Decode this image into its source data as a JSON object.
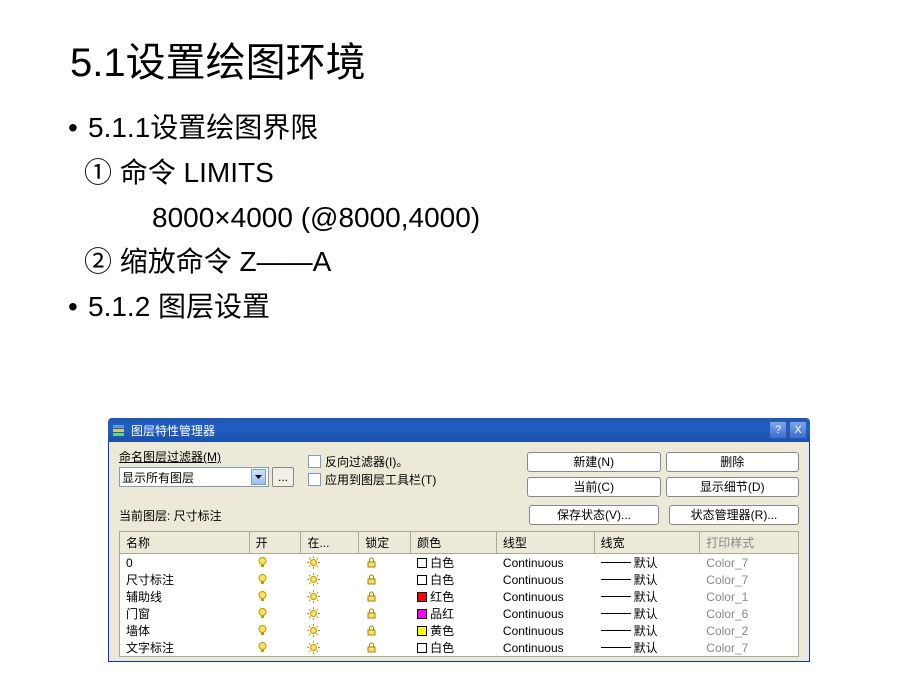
{
  "heading": "5.1设置绘图环境",
  "bullets": {
    "b1": "5.1.1设置绘图界限",
    "s1": "① 命令 LIMITS",
    "s2": "8000×4000 (@8000,4000)",
    "s3": "② 缩放命令 Z——A",
    "b2": "5.1.2 图层设置"
  },
  "dialog": {
    "title": "图层特性管理器",
    "help_btn": "?",
    "close_btn": "X",
    "named_filters_label": "命名图层过滤器(M)",
    "filter_combo_value": "显示所有图层",
    "ellipsis": "...",
    "invert_filter": "反向过滤器(I)。",
    "apply_toolbar": "应用到图层工具栏(T)",
    "btn_new": "新建(N)",
    "btn_delete": "删除",
    "btn_current": "当前(C)",
    "btn_details": "显示细节(D)",
    "btn_save_state": "保存状态(V)...",
    "btn_state_mgr": "状态管理器(R)...",
    "current_layer_label": "当前图层: 尺寸标注",
    "columns": {
      "name": "名称",
      "on": "开",
      "freeze": "在...",
      "lock": "锁定",
      "color": "颜色",
      "linetype": "线型",
      "lineweight": "线宽",
      "plotstyle": "打印样式"
    },
    "layers": [
      {
        "name": "0",
        "color_name": "白色",
        "color_hex": "#ffffff",
        "linetype": "Continuous",
        "lw": "默认",
        "plot": "Color_7"
      },
      {
        "name": "尺寸标注",
        "color_name": "白色",
        "color_hex": "#ffffff",
        "linetype": "Continuous",
        "lw": "默认",
        "plot": "Color_7"
      },
      {
        "name": "辅助线",
        "color_name": "红色",
        "color_hex": "#ff0000",
        "linetype": "Continuous",
        "lw": "默认",
        "plot": "Color_1"
      },
      {
        "name": "门窗",
        "color_name": "品红",
        "color_hex": "#ff00ff",
        "linetype": "Continuous",
        "lw": "默认",
        "plot": "Color_6"
      },
      {
        "name": "墙体",
        "color_name": "黄色",
        "color_hex": "#ffff00",
        "linetype": "Continuous",
        "lw": "默认",
        "plot": "Color_2"
      },
      {
        "name": "文字标注",
        "color_name": "白色",
        "color_hex": "#ffffff",
        "linetype": "Continuous",
        "lw": "默认",
        "plot": "Color_7"
      }
    ]
  }
}
